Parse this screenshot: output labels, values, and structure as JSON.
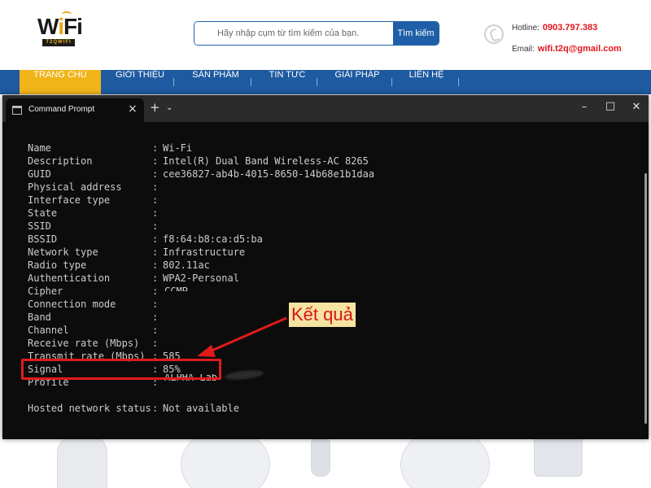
{
  "site": {
    "logo_text": "WiFi",
    "logo_sub": "T2QWIFI",
    "search": {
      "placeholder": "Hãy nhập cụm từ tìm kiếm của bạn.",
      "button": "Tìm kiếm"
    },
    "contact": {
      "hotline_label": "Hotline:",
      "hotline_value": "0903.797.383",
      "email_label": "Email:",
      "email_value": "wifi.t2q@gmail.com"
    },
    "nav": [
      "TRANG CHỦ",
      "GIỚI THIỆU",
      "SẢN PHẨM",
      "TIN TỨC",
      "GIẢI PHÁP",
      "LIÊN HỆ"
    ],
    "nav_active": 0
  },
  "terminal": {
    "tab_title": "Command Prompt",
    "controls": {
      "close_tab": "×",
      "new_tab": "+",
      "dropdown": "⌄",
      "minimize": "–",
      "maximize": "□",
      "close": "✕"
    },
    "lines": [
      {
        "key": "Name",
        "value": "Wi-Fi"
      },
      {
        "key": "Description",
        "value": "Intel(R) Dual Band Wireless-AC 8265"
      },
      {
        "key": "GUID",
        "value": "cee36827-ab4b-4015-8650-14b68e1b1daa"
      },
      {
        "key": "Physical address",
        "value": ""
      },
      {
        "key": "Interface type",
        "value": ""
      },
      {
        "key": "State",
        "value": ""
      },
      {
        "key": "SSID",
        "value": ""
      },
      {
        "key": "BSSID",
        "value": "f8:64:b8:ca:d5:ba"
      },
      {
        "key": "Network type",
        "value": "Infrastructure"
      },
      {
        "key": "Radio type",
        "value": "802.11ac"
      },
      {
        "key": "Authentication",
        "value": "WPA2-Personal"
      },
      {
        "key": "Cipher",
        "value": ""
      },
      {
        "key": "Connection mode",
        "value": ""
      },
      {
        "key": "Band",
        "value": ""
      },
      {
        "key": "Channel",
        "value": ""
      },
      {
        "key": "Receive rate (Mbps)",
        "value": ""
      },
      {
        "key": "Transmit rate (Mbps)",
        "value": "585"
      },
      {
        "key": "Signal",
        "value": "85%"
      },
      {
        "key": "Profile",
        "value": ""
      },
      {
        "key": "",
        "value": ""
      },
      {
        "key": "Hosted network status",
        "value": "Not available"
      }
    ],
    "ghost_cipher": "CCMP",
    "ghost_profile": "ALPHA Lab"
  },
  "annotation": {
    "label": "Kết quả",
    "color": "#e01b1b"
  },
  "colors": {
    "nav_bg": "#1e5aa0",
    "nav_active": "#f0b419",
    "accent_red": "#e0141e",
    "terminal_bg": "#0c0c0c"
  }
}
